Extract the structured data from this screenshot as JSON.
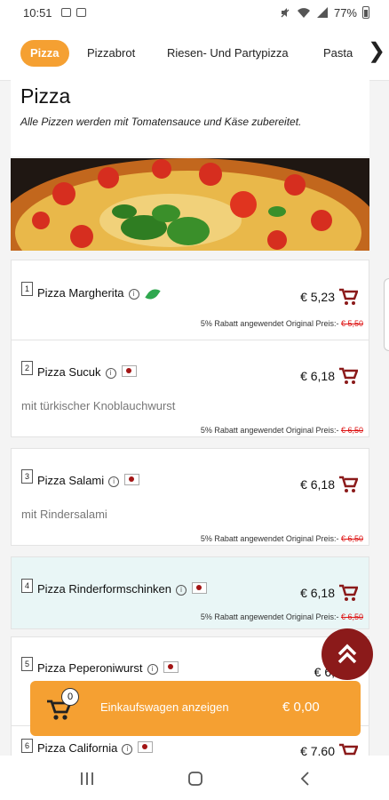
{
  "status": {
    "time": "10:51",
    "battery": "77%"
  },
  "tabs": {
    "items": [
      {
        "label": "Pizza"
      },
      {
        "label": "Pizzabrot"
      },
      {
        "label": "Riesen- Und Partypizza"
      },
      {
        "label": "Pasta"
      }
    ],
    "next_glyph": "❯"
  },
  "category": {
    "title": "Pizza",
    "description": "Alle Pizzen werden mit Tomatensauce und Käse zubereitet."
  },
  "discount_text": "5% Rabatt angewendet Original Preis:-",
  "items": [
    {
      "number": "1",
      "name": "Pizza Margherita",
      "price": "€ 5,23",
      "original": "€ 5,50",
      "description": "",
      "marker": "vegetarian"
    },
    {
      "number": "2",
      "name": "Pizza Sucuk",
      "price": "€ 6,18",
      "original": "€ 6,50",
      "description": "mit türkischer Knoblauchwurst",
      "marker": "flag"
    },
    {
      "number": "3",
      "name": "Pizza Salami",
      "price": "€ 6,18",
      "original": "€ 6,50",
      "description": "mit Rindersalami",
      "marker": "flag"
    },
    {
      "number": "4",
      "name": "Pizza Rinderformschinken",
      "price": "€ 6,18",
      "original": "€ 6,50",
      "description": "",
      "marker": "flag"
    },
    {
      "number": "5",
      "name": "Pizza Peperoniwurst",
      "price": "€ 6,",
      "original": "",
      "description": "",
      "marker": "flag"
    },
    {
      "number": "6",
      "name": "Pizza California",
      "price": "€ 7,60",
      "original": "",
      "description": "",
      "marker": "flag"
    }
  ],
  "cart": {
    "count": "0",
    "label": "Einkaufswagen anzeigen",
    "total": "€ 0,00"
  },
  "colors": {
    "accent": "#f5a032",
    "cart_icon": "#8b1a1a",
    "discount_original": "#dd1111",
    "highlight_row": "#e9f6f6"
  }
}
